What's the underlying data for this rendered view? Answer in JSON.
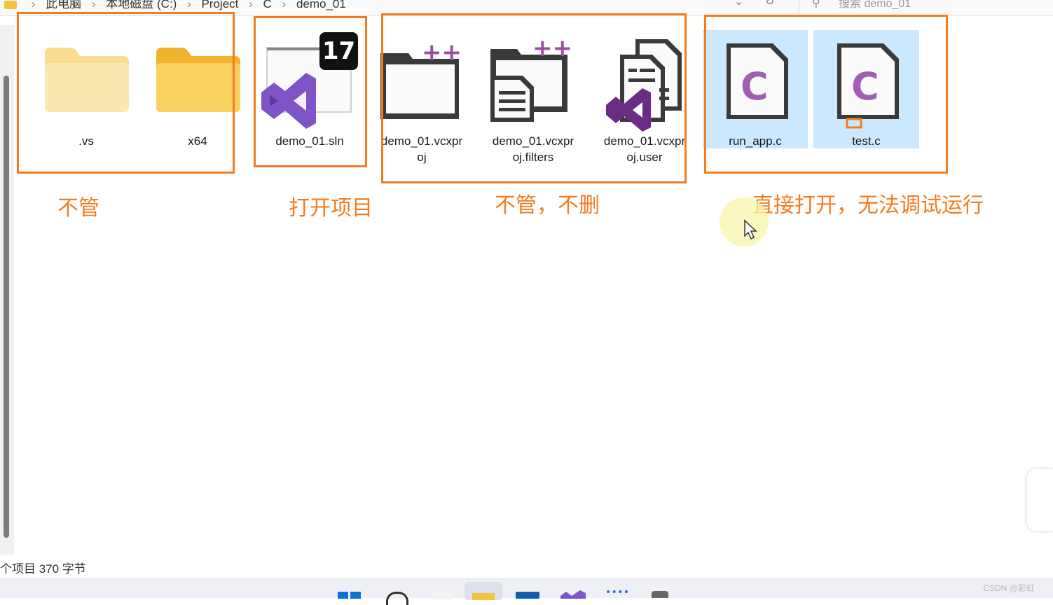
{
  "breadcrumb": {
    "items": [
      "此电脑",
      "本地磁盘 (C:)",
      "Project",
      "C",
      "demo_01"
    ]
  },
  "search": {
    "placeholder": "搜索 demo_01"
  },
  "files": [
    {
      "name": ".vs",
      "type": "folder"
    },
    {
      "name": "x64",
      "type": "folder"
    },
    {
      "name": "demo_01.sln",
      "type": "vs-solution",
      "badge": "17"
    },
    {
      "name_line1": "demo_01.vcxpr",
      "name_line2": "oj",
      "type": "vcxproj"
    },
    {
      "name_line1": "demo_01.vcxpr",
      "name_line2": "oj.filters",
      "type": "vcxproj-filters"
    },
    {
      "name_line1": "demo_01.vcxpr",
      "name_line2": "oj.user",
      "type": "vcxproj-user"
    },
    {
      "name": "run_app.c",
      "type": "c-source",
      "selected": true
    },
    {
      "name": "test.c",
      "type": "c-source",
      "selected": true
    }
  ],
  "annotations": {
    "ignore": "不管",
    "open_project": "打开项目",
    "ignore_no_delete": "不管，不删",
    "direct_open": "直接打开，无法调试运行"
  },
  "status": {
    "text": "个项目 370 字节"
  },
  "watermark": "CSDN @彩虹",
  "colors": {
    "annotation": "#f47c20",
    "selection": "#cce8ff",
    "vs_purple": "#7d55c7",
    "c_purple": "#a05fb3",
    "folder_yellow": "#f5c242"
  }
}
